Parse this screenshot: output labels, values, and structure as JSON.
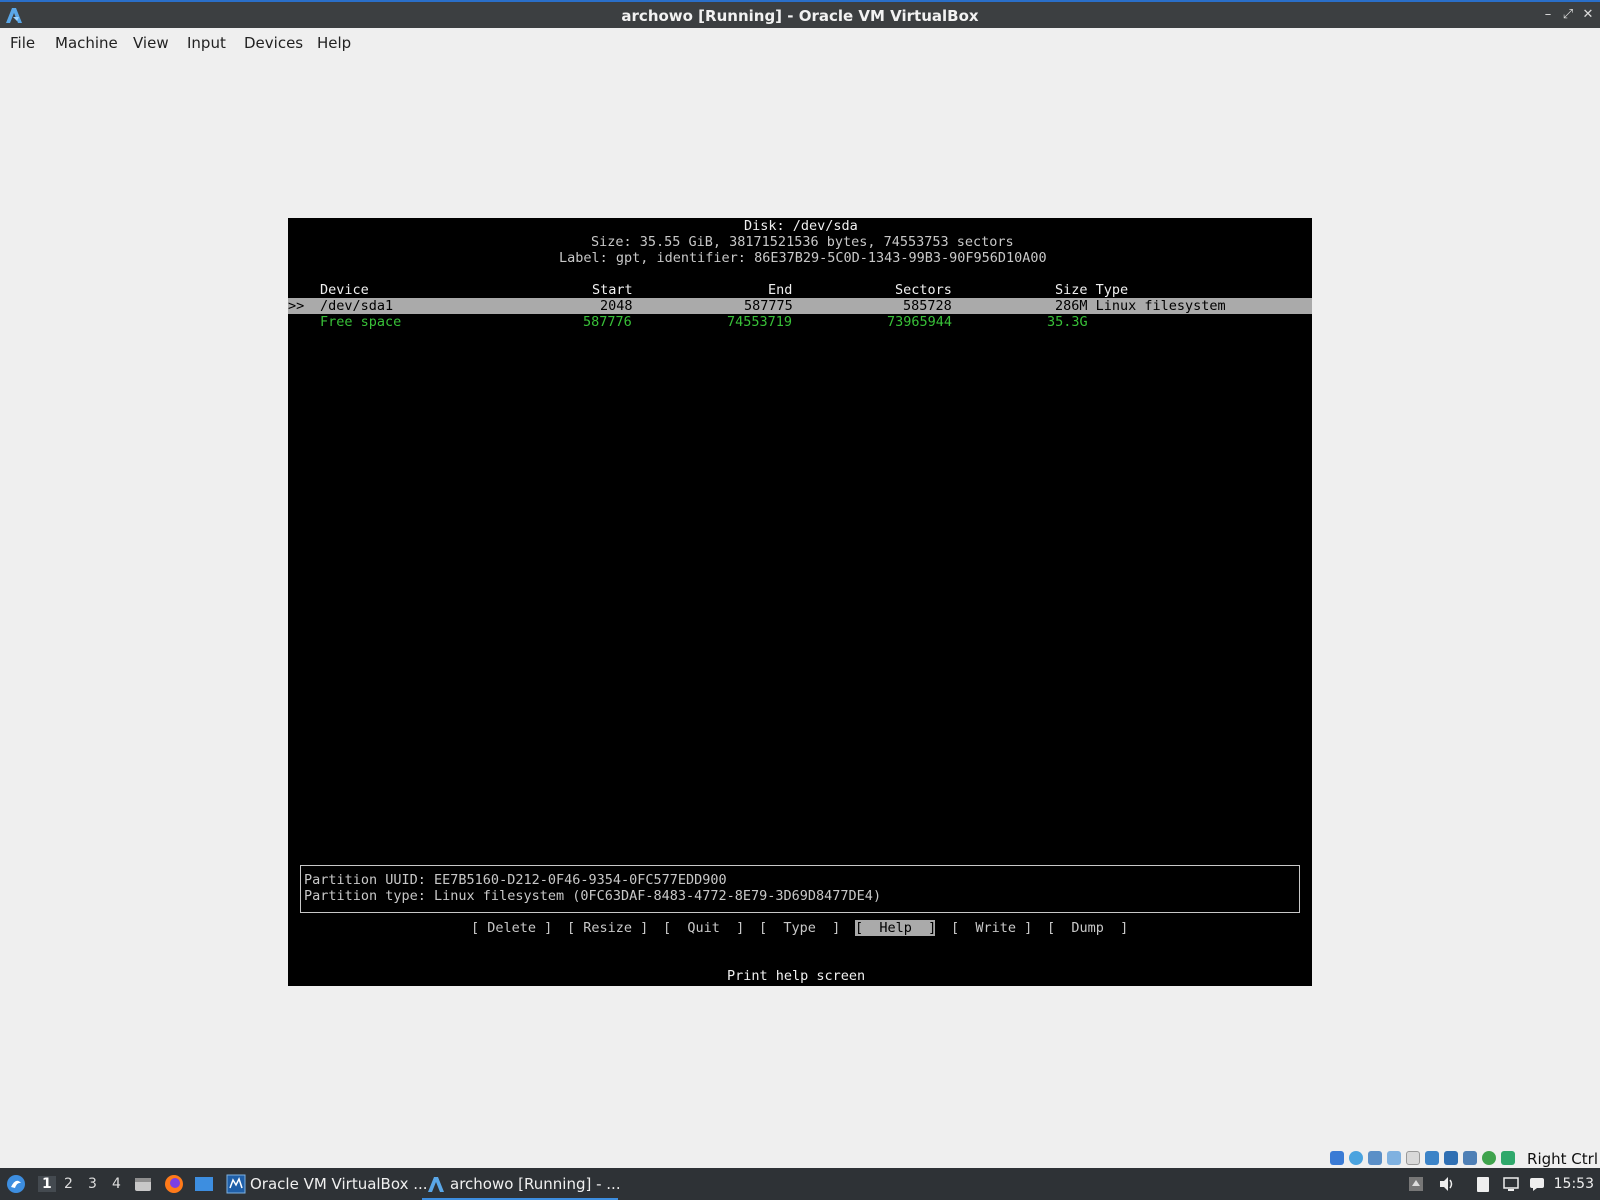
{
  "window": {
    "title": "archowo [Running] - Oracle VM VirtualBox",
    "minimize_glyph": "–",
    "maximize_glyph": "⤢",
    "close_glyph": "✕"
  },
  "menu": [
    "File",
    "Machine",
    "View",
    "Input",
    "Devices",
    "Help"
  ],
  "cfdisk": {
    "disk_line": "Disk: /dev/sda",
    "size_line": "Size: 35.55 GiB, 38171521536 bytes, 74553753 sectors",
    "label_line": "Label: gpt, identifier: 86E37B29-5C0D-1343-99B3-90F956D10A00",
    "headers": {
      "device": "Device",
      "start": "Start",
      "end": "End",
      "sectors": "Sectors",
      "size_type": "Size Type"
    },
    "cursor": ">>",
    "rows": [
      {
        "device": "/dev/sda1",
        "start": "2048",
        "end": "587775",
        "sectors": "585728",
        "size_type": "286M Linux filesystem",
        "selected": true
      },
      {
        "device": "Free space",
        "start": "587776",
        "end": "74553719",
        "sectors": "73965944",
        "size_type": "35.3G",
        "selected": false
      }
    ],
    "info": {
      "uuid_line": "Partition UUID: EE7B5160-D212-0F46-9354-0FC577EDD900",
      "type_line": "Partition type: Linux filesystem (0FC63DAF-8483-4772-8E79-3D69D8477DE4)"
    },
    "buttons": [
      "[ Delete ]",
      "[ Resize ]",
      "[  Quit  ]",
      "[  Type  ]",
      "[  Help  ]",
      "[  Write ]",
      "[  Dump  ]"
    ],
    "selected_button": "[  Help  ]",
    "hint": "Print help screen"
  },
  "statusbar": {
    "host_key": "Right Ctrl",
    "icons": [
      "hard-disk-icon",
      "optical-disk-icon",
      "network-icon",
      "usb-icon",
      "shared-folder-icon",
      "display-icon",
      "recording-icon",
      "cpu-icon",
      "mouse-integration-icon",
      "keyboard-icon"
    ]
  },
  "taskbar": {
    "workspaces": [
      "1",
      "2",
      "3",
      "4"
    ],
    "active_workspace": "1",
    "tasks": [
      "Oracle VM VirtualBox ...",
      "archowo [Running] - ..."
    ],
    "clock": "15:53"
  },
  "colors": {
    "free_space": "#38c038",
    "selection": "#aaaaaa",
    "terminal_bg": "#000000"
  }
}
